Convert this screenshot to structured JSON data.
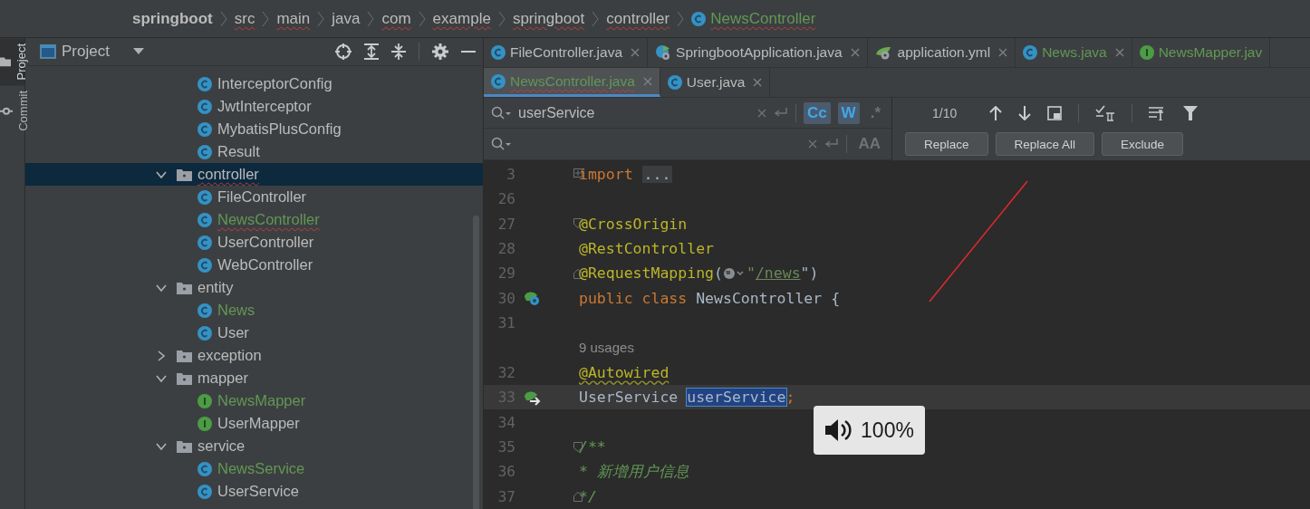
{
  "breadcrumb": [
    {
      "label": "springboot",
      "kind": "project",
      "typo": false,
      "added": false
    },
    {
      "label": "src",
      "kind": "folder",
      "typo": true,
      "added": false
    },
    {
      "label": "main",
      "kind": "folder",
      "typo": true,
      "added": false
    },
    {
      "label": "java",
      "kind": "folder",
      "typo": false,
      "added": false
    },
    {
      "label": "com",
      "kind": "folder",
      "typo": true,
      "added": false
    },
    {
      "label": "example",
      "kind": "folder",
      "typo": true,
      "added": false
    },
    {
      "label": "springboot",
      "kind": "folder",
      "typo": true,
      "added": false
    },
    {
      "label": "controller",
      "kind": "folder",
      "typo": true,
      "added": false
    },
    {
      "label": "NewsController",
      "kind": "class",
      "typo": true,
      "added": true
    }
  ],
  "tool_strip": [
    {
      "label": "Project",
      "selected": true
    },
    {
      "label": "Commit",
      "selected": false
    }
  ],
  "project_panel": {
    "title": "Project",
    "continued_items": [
      {
        "label": "InterceptorConfig",
        "kind": "class",
        "added": false,
        "selected": false,
        "typo": false
      },
      {
        "label": "JwtInterceptor",
        "kind": "class",
        "added": false,
        "selected": false,
        "typo": false
      },
      {
        "label": "MybatisPlusConfig",
        "kind": "class",
        "added": false,
        "selected": false,
        "typo": false
      },
      {
        "label": "Result",
        "kind": "class",
        "added": false,
        "selected": false,
        "typo": false
      }
    ],
    "tree": [
      {
        "label": "controller",
        "kind": "folder",
        "expanded": true,
        "selected": true,
        "typo": true,
        "added": false,
        "children": [
          {
            "label": "FileController",
            "kind": "class",
            "added": false,
            "selected": false,
            "typo": false
          },
          {
            "label": "NewsController",
            "kind": "class",
            "added": true,
            "selected": false,
            "typo": true
          },
          {
            "label": "UserController",
            "kind": "class",
            "added": false,
            "selected": false,
            "typo": false
          },
          {
            "label": "WebController",
            "kind": "class",
            "added": false,
            "selected": false,
            "typo": false
          }
        ]
      },
      {
        "label": "entity",
        "kind": "folder",
        "expanded": true,
        "selected": false,
        "typo": false,
        "added": false,
        "children": [
          {
            "label": "News",
            "kind": "class",
            "added": true,
            "selected": false,
            "typo": false
          },
          {
            "label": "User",
            "kind": "class",
            "added": false,
            "selected": false,
            "typo": false
          }
        ]
      },
      {
        "label": "exception",
        "kind": "folder",
        "expanded": false,
        "selected": false,
        "typo": false,
        "added": false
      },
      {
        "label": "mapper",
        "kind": "folder",
        "expanded": true,
        "selected": false,
        "typo": false,
        "added": false,
        "children": [
          {
            "label": "NewsMapper",
            "kind": "interface",
            "added": true,
            "selected": false,
            "typo": false
          },
          {
            "label": "UserMapper",
            "kind": "interface",
            "added": false,
            "selected": false,
            "typo": false
          }
        ]
      },
      {
        "label": "service",
        "kind": "folder",
        "expanded": true,
        "selected": false,
        "typo": false,
        "added": false,
        "children": [
          {
            "label": "NewsService",
            "kind": "class",
            "added": true,
            "selected": false,
            "typo": false
          },
          {
            "label": "UserService",
            "kind": "class",
            "added": false,
            "selected": false,
            "typo": false
          }
        ]
      }
    ]
  },
  "editor_tabs": [
    [
      {
        "label": "FileController.java",
        "kind": "class",
        "added": false,
        "selected": false,
        "typo": false
      },
      {
        "label": "SpringbootApplication.java",
        "kind": "spring",
        "added": false,
        "selected": false,
        "typo": false
      },
      {
        "label": "application.yml",
        "kind": "yaml",
        "added": false,
        "selected": false,
        "typo": false
      },
      {
        "label": "News.java",
        "kind": "class",
        "added": true,
        "selected": false,
        "typo": false
      },
      {
        "label": "NewsMapper.jav",
        "kind": "interface",
        "added": true,
        "selected": false,
        "typo": false
      }
    ],
    [
      {
        "label": "NewsController.java",
        "kind": "class",
        "added": true,
        "selected": true,
        "typo": true
      },
      {
        "label": "User.java",
        "kind": "class",
        "added": false,
        "selected": false,
        "typo": false
      }
    ]
  ],
  "find_bar": {
    "search_value": "userService",
    "search_toggles": [
      {
        "label": "Cc",
        "selected": true
      },
      {
        "label": "W",
        "selected": true
      },
      {
        "label": ".*",
        "selected": false
      }
    ],
    "replace_toggles": [
      {
        "label": "AA",
        "selected": false
      }
    ],
    "match_count": "1/10",
    "buttons": [
      "Replace",
      "Replace All",
      "Exclude"
    ]
  },
  "code_lines": [
    {
      "number": "3",
      "fold_marker": {
        "kind": "plus"
      },
      "current": false,
      "tokens": [
        {
          "text": "import",
          "kind": "keyword"
        },
        {
          "text": "...",
          "kind": "folded"
        }
      ]
    },
    {
      "number": "26",
      "current": false
    },
    {
      "number": "27",
      "fold_marker": {
        "kind": "start"
      },
      "current": false,
      "tokens": [
        {
          "text": "@CrossOrigin",
          "kind": "annotation"
        }
      ]
    },
    {
      "number": "28",
      "current": false,
      "tokens": [
        {
          "text": "@RestController",
          "kind": "annotation"
        }
      ]
    },
    {
      "number": "29",
      "fold_marker": {
        "kind": "end"
      },
      "current": false,
      "tokens": [
        {
          "text": "@RequestMapping",
          "kind": "annotation"
        },
        {
          "text": "(",
          "kind": "plain"
        },
        {
          "kind": "web-icon"
        },
        {
          "text": "\"",
          "kind": "string"
        },
        {
          "text": "/news",
          "kind": "link"
        },
        {
          "text": "\")",
          "kind": "plain"
        }
      ]
    },
    {
      "number": "30",
      "gutter_marker": {
        "kind": "bean"
      },
      "current": false,
      "tokens": [
        {
          "text": "public class ",
          "kind": "keyword"
        },
        {
          "text": "NewsController {",
          "kind": "plain"
        }
      ]
    },
    {
      "number": "31",
      "current": false
    },
    {
      "current": false,
      "tokens": [
        {
          "text": "    9 usages",
          "kind": "hint"
        }
      ]
    },
    {
      "number": "32",
      "current": false,
      "tokens": [
        {
          "text": "    @Autowired",
          "kind": "annotation-warn"
        }
      ]
    },
    {
      "number": "33",
      "gutter_marker": {
        "kind": "inject"
      },
      "current": true,
      "tokens": [
        {
          "text": "    UserService ",
          "kind": "plain"
        },
        {
          "text": "userService",
          "kind": "match"
        },
        {
          "text": ";",
          "kind": "keyword"
        }
      ]
    },
    {
      "number": "34",
      "current": false
    },
    {
      "number": "35",
      "fold_marker": {
        "kind": "start"
      },
      "current": false,
      "tokens": [
        {
          "text": "    /**",
          "kind": "comment"
        }
      ]
    },
    {
      "number": "36",
      "current": false,
      "tokens": [
        {
          "text": "     * 新增用户信息",
          "kind": "comment"
        }
      ]
    },
    {
      "number": "37",
      "fold_marker": {
        "kind": "end"
      },
      "current": false,
      "tokens": [
        {
          "text": "     */",
          "kind": "comment"
        }
      ]
    }
  ],
  "volume_overlay": {
    "reading": "100%"
  }
}
